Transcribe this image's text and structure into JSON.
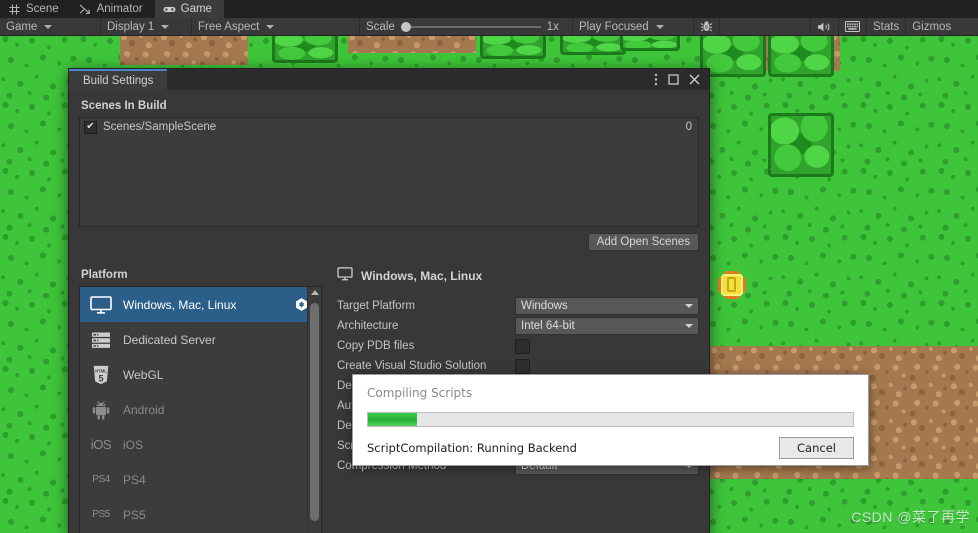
{
  "editor": {
    "tabs": [
      {
        "label": "Scene",
        "icon": "grid-icon",
        "active": false
      },
      {
        "label": "Animator",
        "icon": "animator-icon",
        "active": false
      },
      {
        "label": "Game",
        "icon": "gamepad-icon",
        "active": true
      }
    ],
    "toolbar": {
      "view_mode": "Game",
      "display": "Display 1",
      "aspect": "Free Aspect",
      "scale_label": "Scale",
      "scale_value": "1x",
      "play_mode": "Play Focused",
      "debug_icon": "bug-icon",
      "mute_audio_icon": "speaker-icon",
      "stats_grid_icon": "grid-overlay-icon",
      "stats_label": "Stats",
      "gizmos_label": "Gizmos"
    }
  },
  "build_settings": {
    "title": "Build Settings",
    "window_buttons": {
      "menu_icon": "kebab-menu-icon",
      "maximize_icon": "maximize-icon",
      "close_icon": "close-icon"
    },
    "scenes_in_build_label": "Scenes In Build",
    "scenes": [
      {
        "name": "Scenes/SampleScene",
        "checked": true,
        "index": "0",
        "check_glyph": "✔"
      }
    ],
    "add_open_scenes_label": "Add Open Scenes",
    "platform_label": "Platform",
    "platforms": [
      {
        "label": "Windows, Mac, Linux",
        "icon": "desktop-icon",
        "selected": true,
        "disabled": false,
        "badge": "unity-logo-icon"
      },
      {
        "label": "Dedicated Server",
        "icon": "server-icon",
        "selected": false,
        "disabled": false,
        "badge": ""
      },
      {
        "label": "WebGL",
        "icon": "html5-icon",
        "selected": false,
        "disabled": false,
        "badge": ""
      },
      {
        "label": "Android",
        "icon": "android-icon",
        "selected": false,
        "disabled": true,
        "badge": ""
      },
      {
        "label": "iOS",
        "icon": "ios-icon",
        "icon_text": "iOS",
        "selected": false,
        "disabled": true,
        "badge": ""
      },
      {
        "label": "PS4",
        "icon": "ps4-icon",
        "icon_text": "PS4",
        "selected": false,
        "disabled": true,
        "badge": ""
      },
      {
        "label": "PS5",
        "icon": "ps5-icon",
        "icon_text": "PS5",
        "selected": false,
        "disabled": true,
        "badge": ""
      }
    ],
    "settings_header": "Windows, Mac, Linux",
    "settings_header_icon": "desktop-icon",
    "properties": [
      {
        "label": "Target Platform",
        "type": "dropdown",
        "value": "Windows"
      },
      {
        "label": "Architecture",
        "type": "dropdown",
        "value": "Intel 64-bit"
      },
      {
        "label": "Copy PDB files",
        "type": "checkbox",
        "value": false
      },
      {
        "label": "Create Visual Studio Solution",
        "type": "checkbox",
        "value": false
      },
      {
        "label": "Development Build",
        "type": "checkbox",
        "value": false
      },
      {
        "label": "Autoconnect Profiler",
        "type": "checkbox",
        "value": false
      },
      {
        "label": "Deep Profiling",
        "type": "checkbox",
        "value": false
      },
      {
        "label": "Script Debugging",
        "type": "checkbox",
        "value": false
      },
      {
        "label": "Compression Method",
        "type": "dropdown",
        "value": "Default"
      }
    ]
  },
  "compiling_dialog": {
    "title": "Compiling Scripts",
    "status": "ScriptCompilation: Running Backend",
    "cancel_label": "Cancel",
    "progress_percent": 10,
    "progress_color": "#2eb83c"
  },
  "game": {
    "watermark": "CSDN @菜了再学",
    "grass_color": "#3ec53a",
    "dirt_color": "#a4794f",
    "bush_color": "#2fa32c",
    "coin_color": "#f2e33c"
  }
}
